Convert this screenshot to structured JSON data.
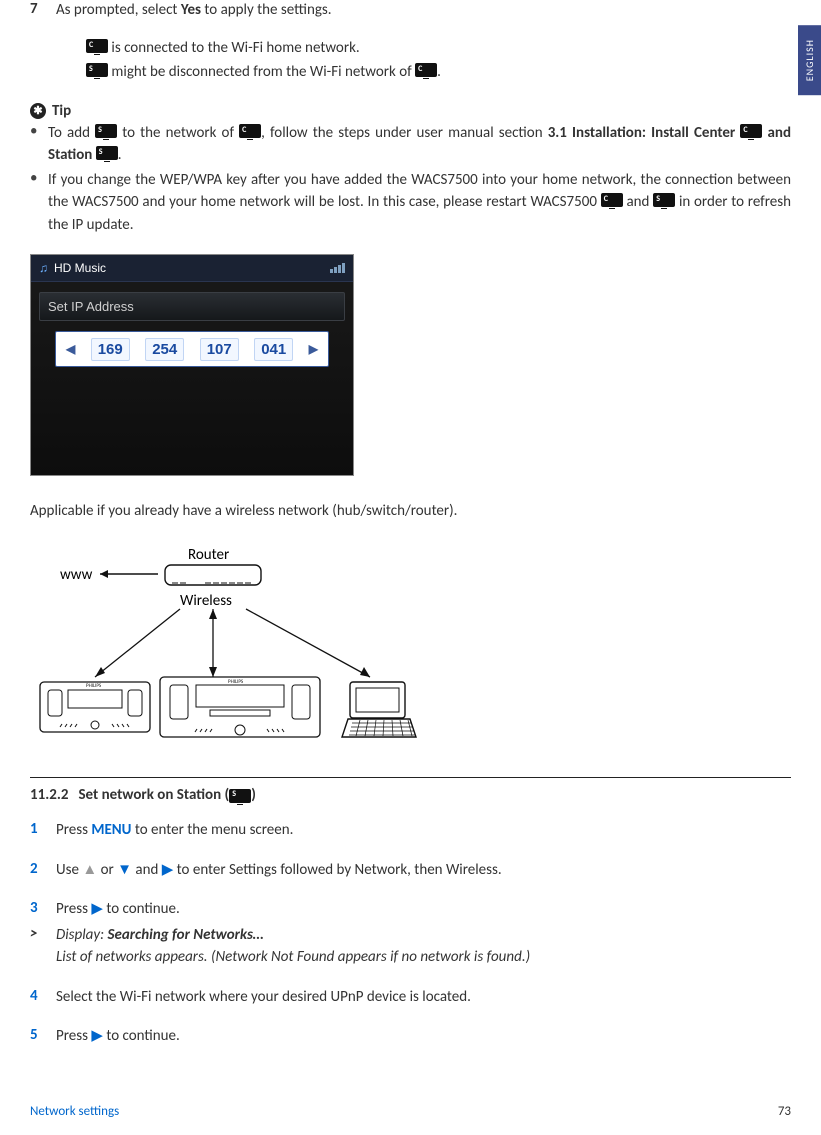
{
  "lang_tab": "ENGLISH",
  "step7": {
    "num": "7",
    "text_prefix": "As prompted, select ",
    "bold": "Yes",
    "text_suffix": " to apply the settings."
  },
  "connected_line": {
    "c_icon": "C",
    "text": " is connected to the Wi-Fi home network."
  },
  "disconnected_line": {
    "s_icon": "S",
    "prefix": " might be disconnected from the Wi-Fi network of ",
    "c_icon": "C",
    "suffix": "."
  },
  "tip": {
    "label": "Tip",
    "bullet1": {
      "p1": "To add ",
      "s_icon": "S",
      "p2": " to the network of ",
      "c_icon": "C",
      "p3": ", follow the steps under user manual section ",
      "bold1": "3.1 Installation: Install Center ",
      "c_icon2": "C",
      "mid": " and Station ",
      "s_icon2": "S",
      "end": "."
    },
    "bullet2": {
      "p1": "If you change the WEP/WPA key after you have added the WACS7500 into your home network, the connection between the WACS7500 and your home network will be lost. In this case, please restart WACS7500 ",
      "c_icon": "C",
      "mid": " and ",
      "s_icon": "S",
      "end": " in order to refresh the IP update."
    }
  },
  "device_screen": {
    "title": "HD Music",
    "label": "Set IP Address",
    "octets": [
      "169",
      "254",
      "107",
      "041"
    ]
  },
  "applies_text": "Applicable if you already have a wireless network (hub/switch/router).",
  "diagram": {
    "www": "www",
    "router": "Router",
    "wireless": "Wireless"
  },
  "section": {
    "num": "11.2.2",
    "title_prefix": "Set network on Station (",
    "s_icon": "S",
    "title_suffix": ")"
  },
  "steps": {
    "s1": {
      "num": "1",
      "p1": "Press ",
      "menu": "MENU",
      "p2": " to enter the menu screen."
    },
    "s2": {
      "num": "2",
      "p1": "Use ",
      "p2": " or ",
      "p3": " and ",
      "p4": " to enter Settings followed by Network, then Wireless."
    },
    "s3": {
      "num": "3",
      "p1": "Press ",
      "p2": " to continue."
    },
    "s3b": {
      "gt": ">",
      "p1": "Display: ",
      "bold": "Searching for Networks…",
      "p2": "List of networks appears. (Network Not Found appears if no network is found.)"
    },
    "s4": {
      "num": "4",
      "text": "Select the Wi-Fi network where your desired UPnP device is located."
    },
    "s5": {
      "num": "5",
      "p1": "Press ",
      "p2": " to continue."
    }
  },
  "footer": {
    "left": "Network settings",
    "right": "73"
  }
}
